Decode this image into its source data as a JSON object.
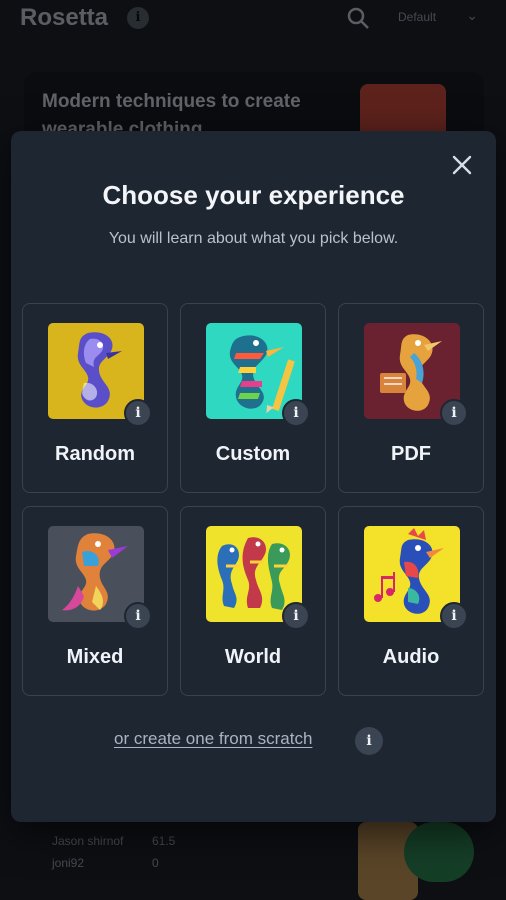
{
  "background": {
    "brand": "Rosetta",
    "select_value": "Default",
    "card_title": "Modern techniques to create wearable clothing",
    "rows": [
      {
        "label": "Jason shirnof",
        "value": "61.5"
      },
      {
        "label": "joni92",
        "value": "0"
      }
    ]
  },
  "modal": {
    "title": "Choose your experience",
    "subtitle": "You will learn about what you pick below.",
    "info_glyph": "i",
    "options": [
      {
        "label": "Random",
        "icon": "seahorse-random-icon",
        "bg": "#d8b51d"
      },
      {
        "label": "Custom",
        "icon": "seahorse-custom-icon",
        "bg": "#2fd8c0"
      },
      {
        "label": "PDF",
        "icon": "seahorse-pdf-icon",
        "bg": "#6b2230"
      },
      {
        "label": "Mixed",
        "icon": "seahorse-mixed-icon",
        "bg": "#4a4f5c"
      },
      {
        "label": "World",
        "icon": "seahorse-world-icon",
        "bg": "#f0e32c"
      },
      {
        "label": "Audio",
        "icon": "seahorse-audio-icon",
        "bg": "#f4e12a"
      }
    ],
    "scratch_link": "or create one from scratch"
  },
  "colors": {
    "modal_bg": "#1e2632",
    "tile_border": "#39424f",
    "info_bg": "#3b4452"
  }
}
